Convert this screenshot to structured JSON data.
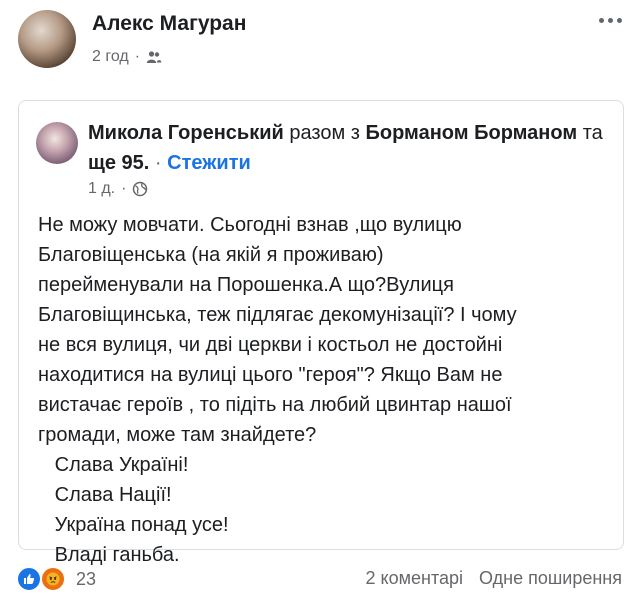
{
  "post": {
    "author": "Алекс Магуран",
    "time": "2 год",
    "separator": "·"
  },
  "shared": {
    "author": "Микола Горенський",
    "with_text": "разом з",
    "tagged": "Борманом Борманом",
    "and_more_text": "та",
    "and_more_count": "ще 95.",
    "separator": "·",
    "follow": "Стежити",
    "time": "1 д.",
    "body": [
      "Не можу мовчати. Сьогодні взнав ,що вулицю",
      "Благовіщенська (на якій я проживаю)",
      "перейменували на Порошенка.А що?Вулиця",
      "Благовіщинська, теж підлягає декомунізації? І чому",
      "не вся вулиця, чи дві церкви і костьол не достойні",
      "находитися на вулиці цього \"героя\"? Якщо Вам не",
      "вистачає героїв , то підіть на любий цвинтар нашої",
      "громади, може там знайдете?",
      "   Слава Україні!",
      "   Слава Нації!",
      "   Україна понад усе!",
      "   Владі ганьба."
    ]
  },
  "footer": {
    "reaction_count": "23",
    "comments": "2 коментарі",
    "shares": "Одне поширення"
  },
  "icons": {
    "audience_main": "friends-icon",
    "audience_shared": "globe-icon",
    "more": "more-options-icon"
  }
}
